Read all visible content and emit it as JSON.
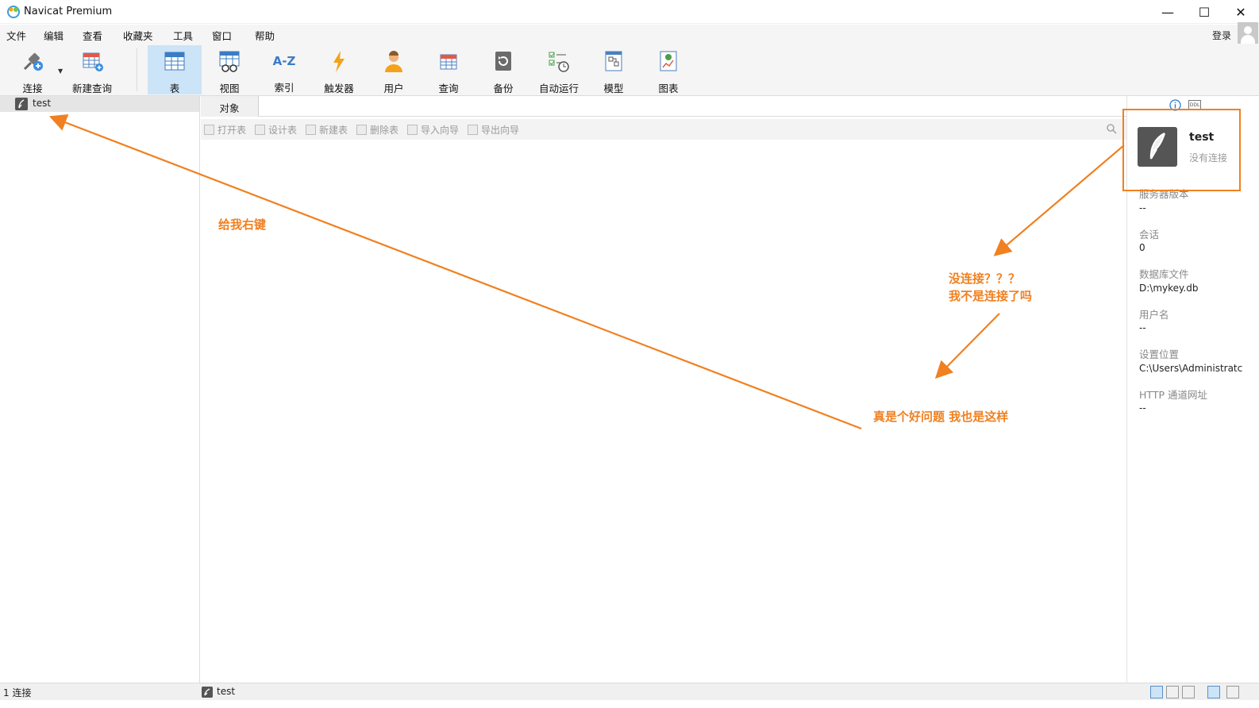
{
  "window": {
    "title": "Navicat Premium",
    "minimize": "—",
    "maximize": "☐",
    "close": "✕"
  },
  "menu": [
    "文件",
    "编辑",
    "查看",
    "收藏夹",
    "工具",
    "窗口",
    "帮助"
  ],
  "login_label": "登录",
  "toolbar": {
    "connect": "连接",
    "new_query": "新建查询",
    "table": "表",
    "view": "视图",
    "index": "索引",
    "index_icon_text": "A-Z",
    "trigger": "触发器",
    "user": "用户",
    "query": "查询",
    "backup": "备份",
    "autorun": "自动运行",
    "model": "模型",
    "chart": "图表"
  },
  "navigator": {
    "connection_name": "test"
  },
  "tabs": {
    "objects": "对象"
  },
  "object_toolbar": {
    "open_table": "打开表",
    "design_table": "设计表",
    "new_table": "新建表",
    "delete_table": "删除表",
    "import_wizard": "导入向导",
    "export_wizard": "导出向导"
  },
  "info_panel": {
    "ddl_icon_text": "DDL",
    "name": "test",
    "status": "没有连接",
    "fields": [
      {
        "label": "服务器版本",
        "value": "--"
      },
      {
        "label": "会话",
        "value": "0"
      },
      {
        "label": "数据库文件",
        "value": "D:\\mykey.db"
      },
      {
        "label": "用户名",
        "value": "--"
      },
      {
        "label": "设置位置",
        "value": "C:\\Users\\Administratc"
      },
      {
        "label": "HTTP 通道网址",
        "value": "--"
      }
    ]
  },
  "statusbar": {
    "left": "1 连接",
    "connection": "test"
  },
  "annotations": {
    "right_click": "给我右键",
    "question_line1": "没连接？？？",
    "question_line2": "我不是连接了吗",
    "good_question": "真是个好问题 我也是这样",
    "color": "#f08020"
  }
}
